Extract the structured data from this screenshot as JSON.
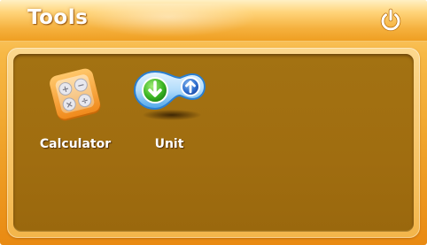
{
  "window": {
    "title": "Tools"
  },
  "header": {
    "power_icon": "power-icon"
  },
  "tools": [
    {
      "label": "Calculator",
      "icon": "calculator-icon"
    },
    {
      "label": "Unit",
      "icon": "unit-converter-icon"
    }
  ],
  "colors": {
    "header_gradient_top": "#fff0c4",
    "header_gradient_bottom": "#ef9f22",
    "panel_inner": "#a37212",
    "label_text": "#ffffff"
  }
}
